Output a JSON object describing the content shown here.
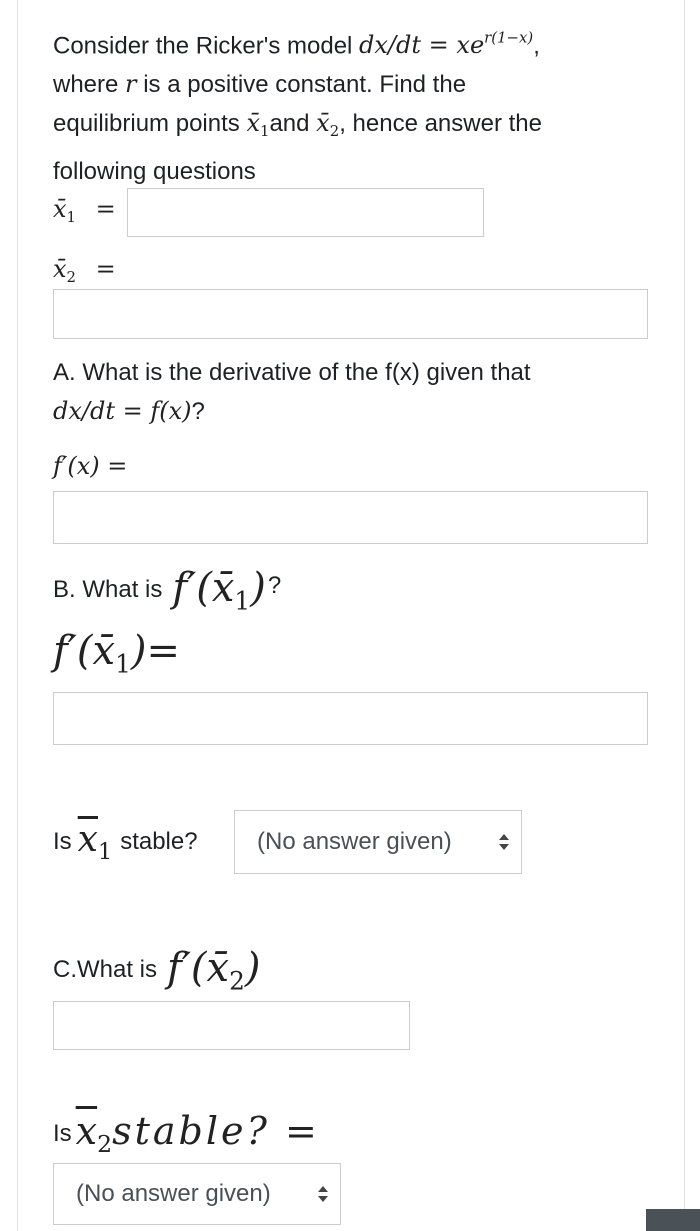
{
  "intro": {
    "line1_text": "Consider the Ricker's model",
    "line1_math": "dx/dt = xe",
    "line1_exponent": "r(1−x)",
    "line1_suffix": ",",
    "line2_pre": "where",
    "line2_var": "r",
    "line2_post": "is a positive constant. Find the",
    "line3_pre": "equilibrium points",
    "line3_x1": "x̄",
    "line3_x1_sub": "1",
    "line3_and": "and",
    "line3_x2": "x̄",
    "line3_x2_sub": "2",
    "line3_post": ", hence answer the",
    "line4": "following questions"
  },
  "x1_field": {
    "label_var": "x̄",
    "label_sub": "1",
    "label_eq": "=",
    "value": ""
  },
  "x2_field": {
    "label_var": "x̄",
    "label_sub": "2",
    "label_eq": "=",
    "value": ""
  },
  "question_a": {
    "text": "A. What is the derivative of the f(x) given that",
    "math": "dx/dt = f(x)",
    "math_suffix": "?",
    "answer_label": "f′(x) =",
    "value": ""
  },
  "question_b": {
    "prefix": "B. What is",
    "math": "f′(x̄",
    "math_sub": "1",
    "math_close": ")",
    "suffix": "?",
    "answer_label": "f′(x̄",
    "answer_sub": "1",
    "answer_close": ")=",
    "value": ""
  },
  "stability_1": {
    "prefix": "Is",
    "var": "x",
    "sub": "1",
    "suffix": "stable?",
    "selected": "(No answer given)"
  },
  "question_c": {
    "prefix": "C.What is",
    "math": "f′(x̄",
    "math_sub": "2",
    "math_close": ")",
    "value": ""
  },
  "stability_2": {
    "prefix": "Is",
    "var": "x",
    "sub": "2",
    "suffix": "stable? =",
    "selected": "(No answer given)"
  }
}
